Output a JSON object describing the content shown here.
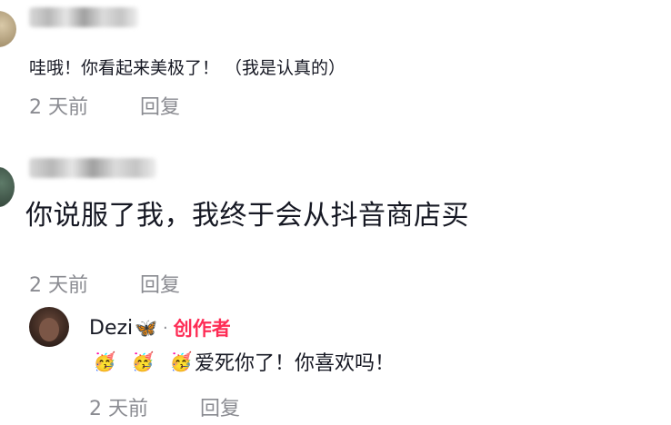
{
  "comments": [
    {
      "text": "哇哦！你看起来美极了！ （我是认真的）",
      "time": "2 天前",
      "reply": "回复"
    },
    {
      "text": "你说服了我，我终于会从抖音商店买",
      "time": "2 天前",
      "reply": "回复"
    }
  ],
  "reply": {
    "author": "Dezi",
    "author_emoji": "🦋",
    "separator": "·",
    "badge": "创作者",
    "emojis": [
      "🥳",
      "🥳",
      "🥳"
    ],
    "text": "爱死你了！你喜欢吗！",
    "time": "2 天前",
    "reply": "回复"
  },
  "colors": {
    "badge": "#fe2c55",
    "meta": "#8a8b91",
    "text": "#161823"
  }
}
